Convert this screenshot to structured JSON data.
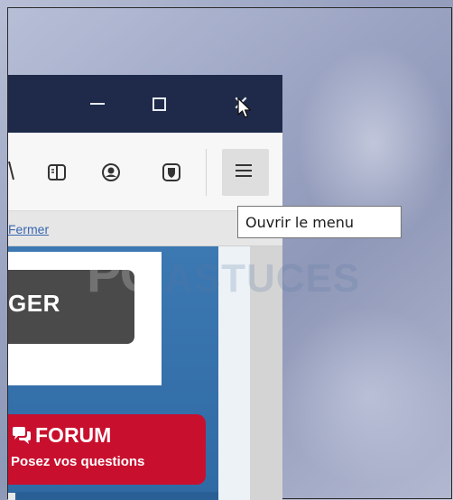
{
  "window": {
    "buttons": {
      "minimize": "minimize-icon",
      "maximize": "maximize-icon",
      "close": "close-icon",
      "close_glyph": "✕"
    }
  },
  "toolbar": {
    "icons": [
      "reader-view-icon",
      "account-icon",
      "shield-icon",
      "hamburger-menu-icon"
    ]
  },
  "notification": {
    "close_link": "Fermer"
  },
  "page": {
    "download_button_text": "GER",
    "forum_title": "FORUM",
    "forum_subtitle": "Posez vos questions"
  },
  "watermark": {
    "brand_a": "PC",
    "brand_b": "ASTUCES"
  },
  "tooltip": {
    "text": "Ouvrir le menu"
  },
  "colors": {
    "titlebar": "#1f2a4a",
    "toolbar": "#f7f7f8",
    "page_blue": "#3c78b2",
    "forum_red": "#c8102e",
    "download_dark": "#4a4a4a"
  }
}
